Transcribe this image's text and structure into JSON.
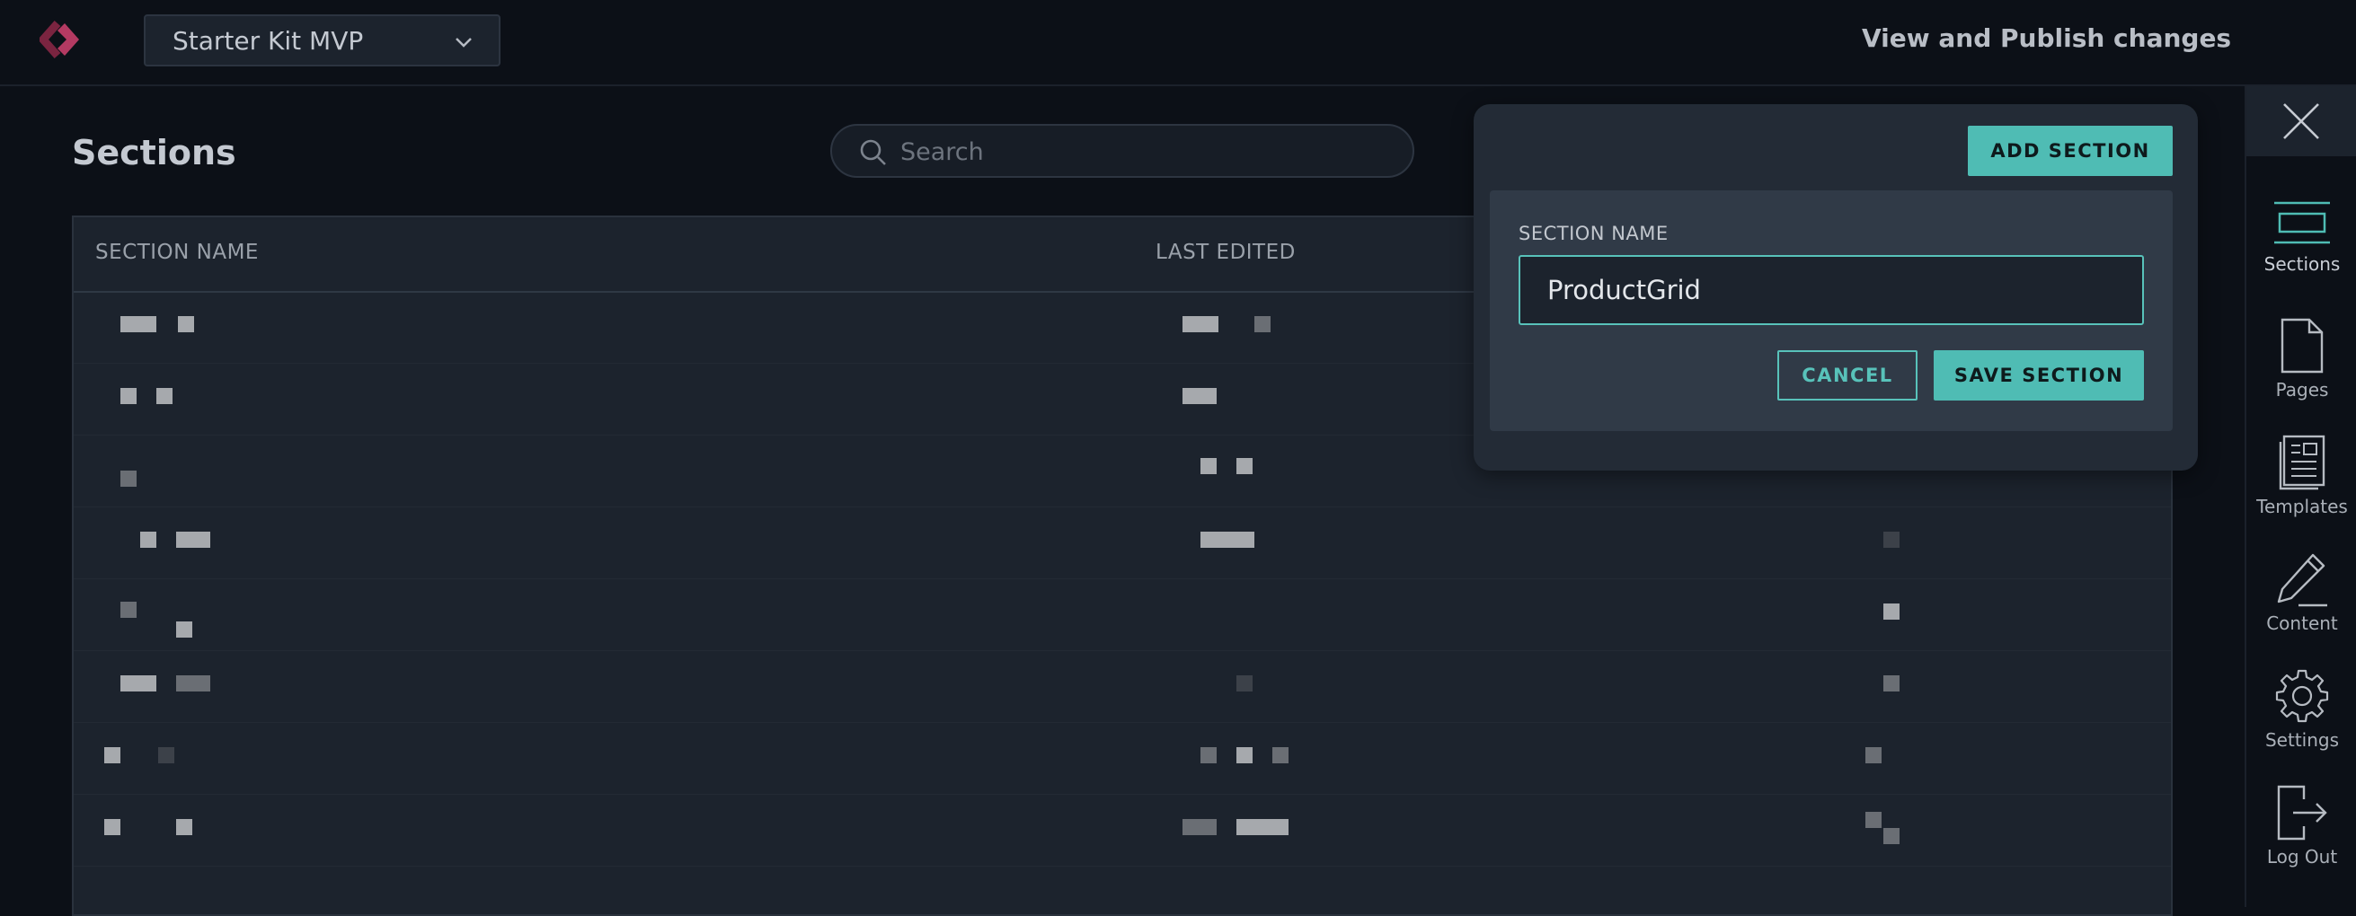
{
  "header": {
    "project_name": "Starter Kit MVP",
    "publish_label": "View and Publish changes"
  },
  "main": {
    "title": "Sections",
    "search_placeholder": "Search",
    "table": {
      "columns": [
        "SECTION NAME",
        "LAST EDITED"
      ]
    }
  },
  "popover": {
    "add_section_label": "ADD SECTION",
    "field_label": "SECTION NAME",
    "field_value": "ProductGrid",
    "cancel_label": "CANCEL",
    "save_label": "SAVE SECTION"
  },
  "rail": {
    "items": [
      {
        "label": "Sections",
        "icon": "sections-icon"
      },
      {
        "label": "Pages",
        "icon": "page-icon"
      },
      {
        "label": "Templates",
        "icon": "templates-icon"
      },
      {
        "label": "Content",
        "icon": "pencil-icon"
      },
      {
        "label": "Settings",
        "icon": "gear-icon"
      },
      {
        "label": "Log Out",
        "icon": "logout-icon"
      }
    ]
  },
  "colors": {
    "accent": "#4fbcb4",
    "brand": "#b43a62",
    "background": "#0c1017",
    "panel": "#1c232d"
  }
}
